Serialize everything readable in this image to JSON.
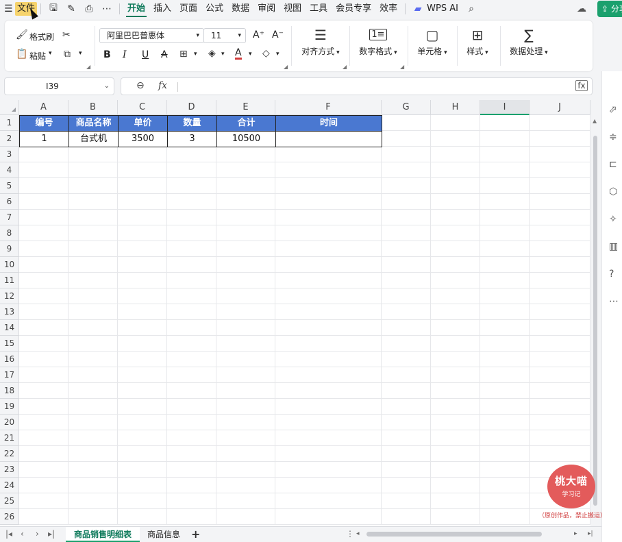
{
  "menubar": {
    "hamburger_glyph": "☰",
    "file": "文件",
    "tabs": [
      "开始",
      "插入",
      "页面",
      "公式",
      "数据",
      "审阅",
      "视图",
      "工具",
      "会员专享",
      "效率"
    ],
    "wps_ai": "WPS AI",
    "share": "分享"
  },
  "ribbon": {
    "format_painter": "格式刷",
    "paste": "粘贴",
    "font_name": "阿里巴巴普惠体",
    "font_size": "11",
    "bold": "B",
    "italic": "I",
    "underline": "U",
    "strike": "A",
    "font_color_glyph": "A",
    "align": "对齐方式",
    "number_format": "数字格式",
    "cells": "单元格",
    "styles": "样式",
    "data_processing": "数据处理",
    "grow_font": "A⁺",
    "shrink_font": "A⁻",
    "number_icon_glyph": "1≡",
    "sum_glyph": "∑"
  },
  "formula": {
    "name_box": "I39",
    "fx": "fx",
    "value": ""
  },
  "grid": {
    "columns": [
      "A",
      "B",
      "C",
      "D",
      "E",
      "F",
      "G",
      "H",
      "I",
      "J"
    ],
    "selected_column": "I",
    "rows": [
      "1",
      "2",
      "3",
      "4",
      "5",
      "6",
      "7",
      "8",
      "9",
      "10",
      "11",
      "12",
      "13",
      "14",
      "15",
      "16",
      "17",
      "18",
      "19",
      "20",
      "21",
      "22",
      "23",
      "24",
      "25",
      "26"
    ],
    "header_row": [
      "编号",
      "商品名称",
      "单价",
      "数量",
      "合计",
      "时间"
    ],
    "data_row": [
      "1",
      "台式机",
      "3500",
      "3",
      "10500",
      ""
    ],
    "header_fill": "#4a78d1"
  },
  "sheets": {
    "tabs": [
      "商品销售明细表",
      "商品信息"
    ],
    "active": "商品销售明细表",
    "add": "+"
  },
  "watermark": {
    "name": "桃大喵",
    "sub": "学习记",
    "note": "（原创作品，禁止搬运）"
  },
  "colors": {
    "accent": "#1aa06d",
    "accent_text": "#0e7a5b",
    "file_highlight": "#f6d36c",
    "watermark": "#e35b5b"
  }
}
